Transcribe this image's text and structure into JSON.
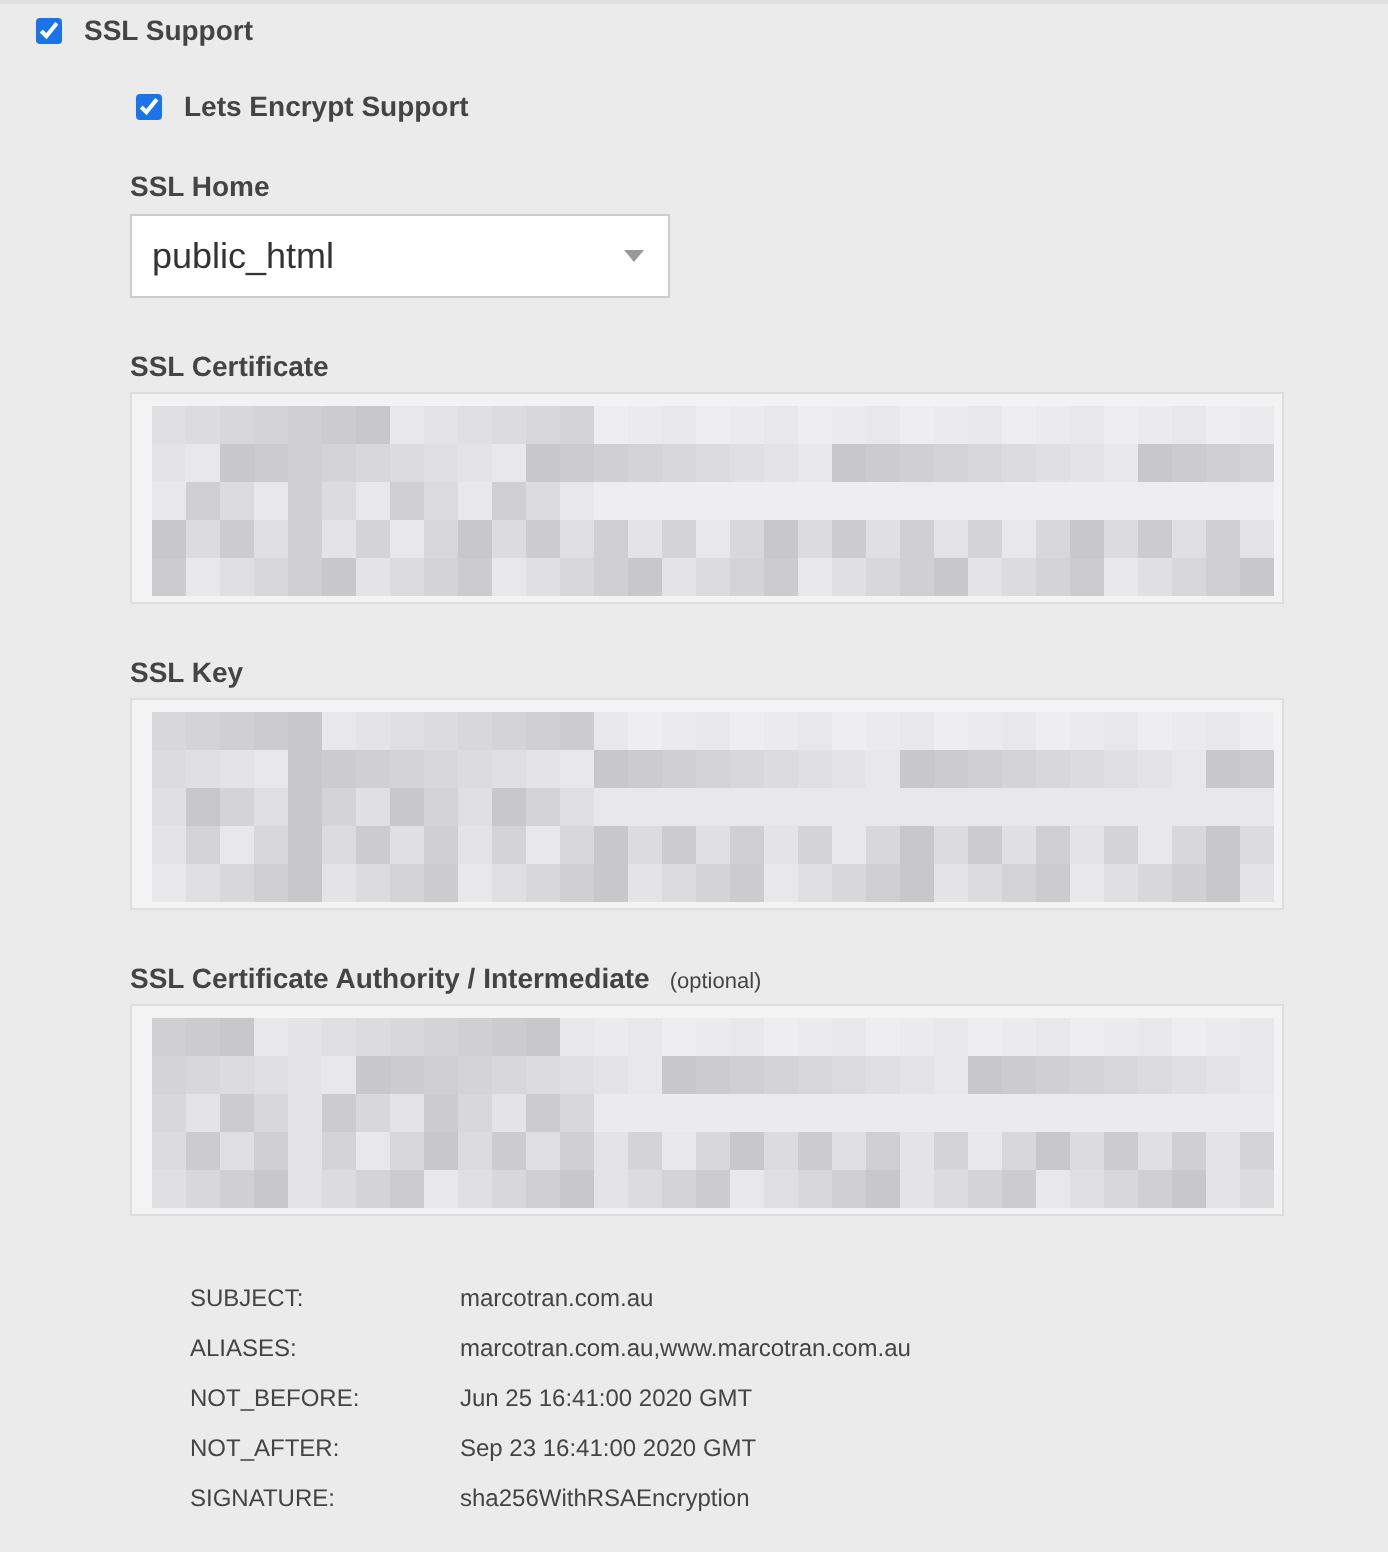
{
  "ssl_support": {
    "label": "SSL Support",
    "checked": true
  },
  "lets_encrypt": {
    "label": "Lets Encrypt Support",
    "checked": true
  },
  "ssl_home": {
    "label": "SSL Home",
    "value": "public_html"
  },
  "textareas": [
    {
      "label": "SSL Certificate"
    },
    {
      "label": "SSL Key"
    },
    {
      "label": "SSL Certificate Authority / Intermediate",
      "note": "(optional)"
    }
  ],
  "details": [
    {
      "label": "SUBJECT:",
      "value": "marcotran.com.au"
    },
    {
      "label": "ALIASES:",
      "value": "marcotran.com.au,www.marcotran.com.au"
    },
    {
      "label": "NOT_BEFORE:",
      "value": "Jun 25 16:41:00 2020 GMT"
    },
    {
      "label": "NOT_AFTER:",
      "value": "Sep 23 16:41:00 2020 GMT"
    },
    {
      "label": "SIGNATURE:",
      "value": "sha256WithRSAEncryption"
    }
  ]
}
